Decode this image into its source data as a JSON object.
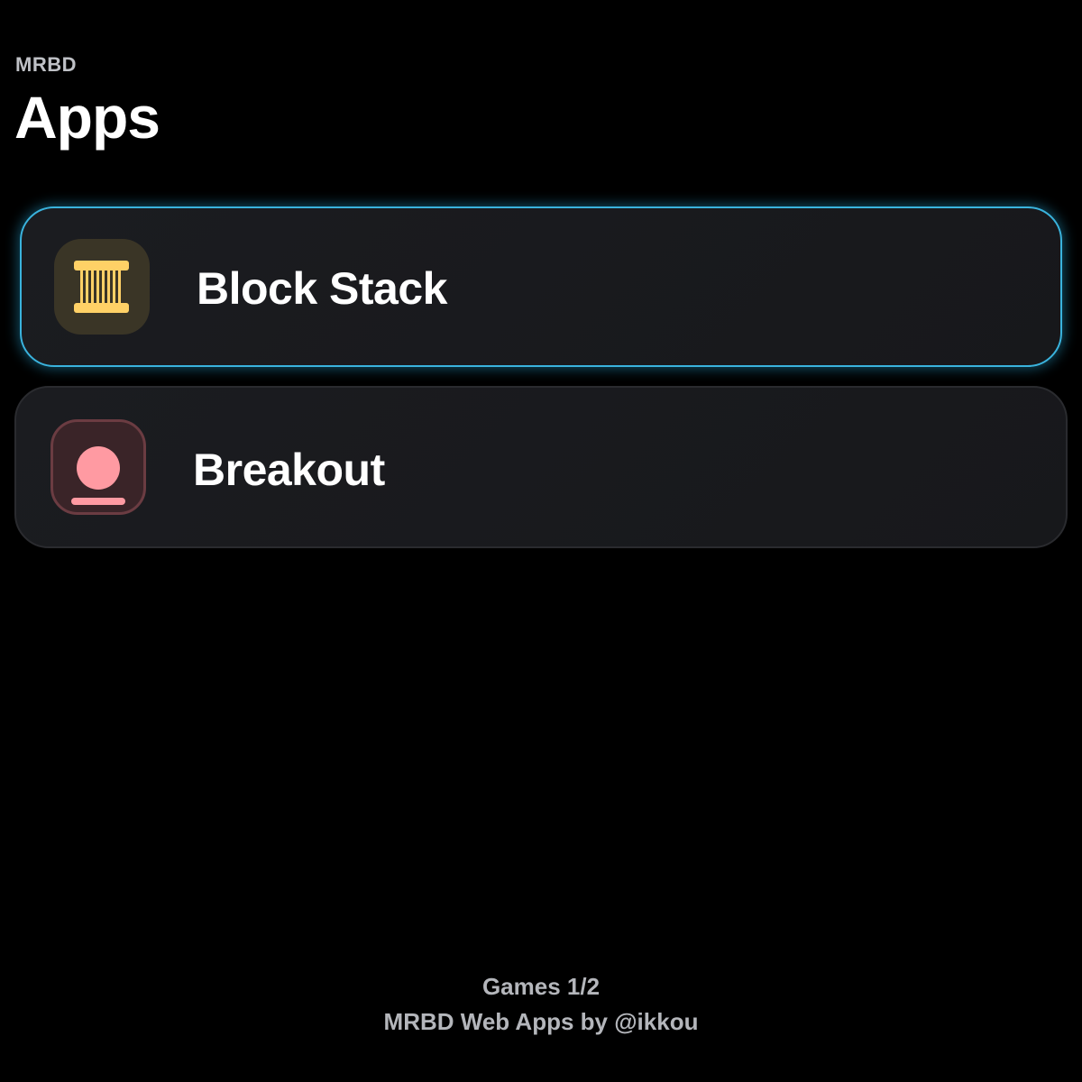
{
  "header": {
    "kicker": "MRBD",
    "title": "Apps"
  },
  "apps": [
    {
      "label": "Block Stack",
      "icon": "block-stack-icon",
      "selected": true,
      "accent": "#ffd166",
      "icon_bg": "#3a3526"
    },
    {
      "label": "Breakout",
      "icon": "breakout-icon",
      "selected": false,
      "accent": "#ff9aa2",
      "icon_bg": "#3a2428"
    }
  ],
  "footer": {
    "page_indicator": "Games 1/2",
    "credit": "MRBD Web Apps by @ikkou"
  },
  "colors": {
    "selection_border": "#3ab3dd",
    "background": "#000000"
  }
}
